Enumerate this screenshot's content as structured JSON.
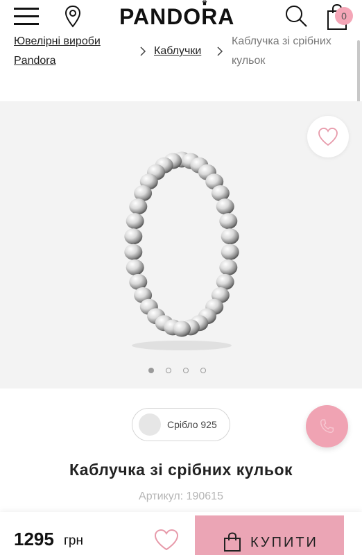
{
  "header": {
    "brand": "PANDORA",
    "crown_glyph": "♛",
    "cart_count": "0",
    "icons": [
      "menu-icon",
      "location-pin-icon",
      "search-icon",
      "shopping-bag-icon"
    ]
  },
  "breadcrumb": {
    "items": [
      {
        "label": "Ювелірні вироби",
        "line2": "Pandora",
        "link": true
      },
      {
        "label": "Каблучки",
        "link": true
      },
      {
        "label": "Каблучка зі срібних",
        "line2": "кульок",
        "link": false
      }
    ]
  },
  "gallery": {
    "image": "ring-image",
    "current_slide": 1,
    "slide_count": 4,
    "background": "#f3f3f3"
  },
  "variant": {
    "label": "Срібло 925",
    "swatch_color": "#e6e6e6"
  },
  "product": {
    "title": "Каблучка зі срібних кульок",
    "sku": "Артикул: 190615"
  },
  "buy_bar": {
    "price": "1295",
    "currency": "грн",
    "buy_label": "КУПИТИ"
  },
  "colors": {
    "accent_pink": "#eba5b5",
    "cart_badge": "#f4a6b7",
    "heart": "#e79aaa"
  }
}
